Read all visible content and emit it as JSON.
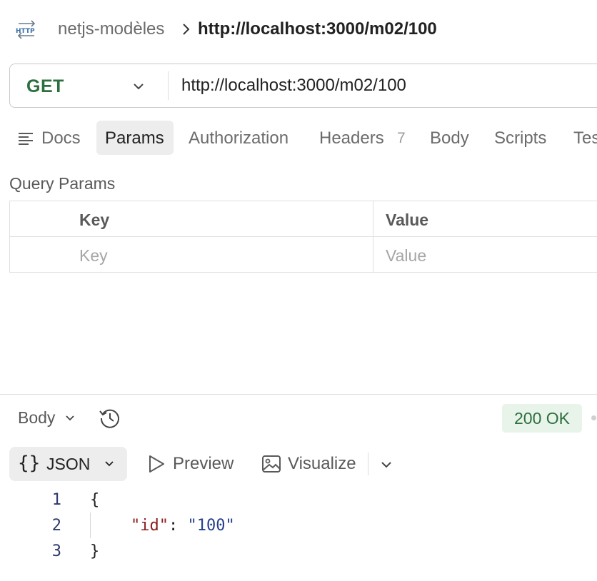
{
  "breadcrumb": {
    "icon": "http-icon",
    "parent": "netjs-modèles",
    "current": "http://localhost:3000/m02/100"
  },
  "request": {
    "method": "GET",
    "url": "http://localhost:3000/m02/100"
  },
  "tabs": {
    "docs": "Docs",
    "params": "Params",
    "authorization": "Authorization",
    "headers": "Headers",
    "headers_count": "7",
    "body": "Body",
    "scripts": "Scripts",
    "tests": "Tes"
  },
  "query_params": {
    "title": "Query Params",
    "key_header": "Key",
    "value_header": "Value",
    "key_placeholder": "Key",
    "value_placeholder": "Value"
  },
  "response": {
    "body_label": "Body",
    "status": "200 OK",
    "status_color": "#2d6f3e",
    "format": "JSON",
    "preview": "Preview",
    "visualize": "Visualize",
    "lines": [
      {
        "num": "1",
        "open": "{"
      },
      {
        "num": "2",
        "key": "\"id\"",
        "colon": ": ",
        "value": "\"100\""
      },
      {
        "num": "3",
        "close": "}"
      }
    ]
  }
}
